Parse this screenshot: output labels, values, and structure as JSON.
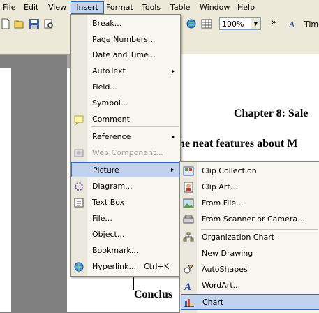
{
  "menubar": {
    "items": [
      "File",
      "Edit",
      "View",
      "Insert",
      "Format",
      "Tools",
      "Table",
      "Window",
      "Help"
    ]
  },
  "toolbar": {
    "zoom": "100%",
    "font": "Time"
  },
  "document": {
    "chapter_heading": "Chapter 8: Sale",
    "features_heading": "he neat features about M",
    "conclusion_heading": "Conclus"
  },
  "insert_menu": {
    "items": [
      {
        "label": "Break..."
      },
      {
        "label": "Page Numbers..."
      },
      {
        "label": "Date and Time..."
      },
      {
        "label": "AutoText"
      },
      {
        "label": "Field..."
      },
      {
        "label": "Symbol..."
      },
      {
        "label": "Comment"
      },
      {
        "label": "Reference"
      },
      {
        "label": "Web Component..."
      },
      {
        "label": "Picture"
      },
      {
        "label": "Diagram..."
      },
      {
        "label": "Text Box"
      },
      {
        "label": "File..."
      },
      {
        "label": "Object..."
      },
      {
        "label": "Bookmark..."
      },
      {
        "label": "Hyperlink...",
        "shortcut": "Ctrl+K"
      }
    ]
  },
  "picture_menu": {
    "items": [
      {
        "label": "Clip Collection"
      },
      {
        "label": "Clip Art..."
      },
      {
        "label": "From File..."
      },
      {
        "label": "From Scanner or Camera..."
      },
      {
        "label": "Organization Chart"
      },
      {
        "label": "New Drawing"
      },
      {
        "label": "AutoShapes"
      },
      {
        "label": "WordArt..."
      },
      {
        "label": "Chart"
      }
    ]
  }
}
